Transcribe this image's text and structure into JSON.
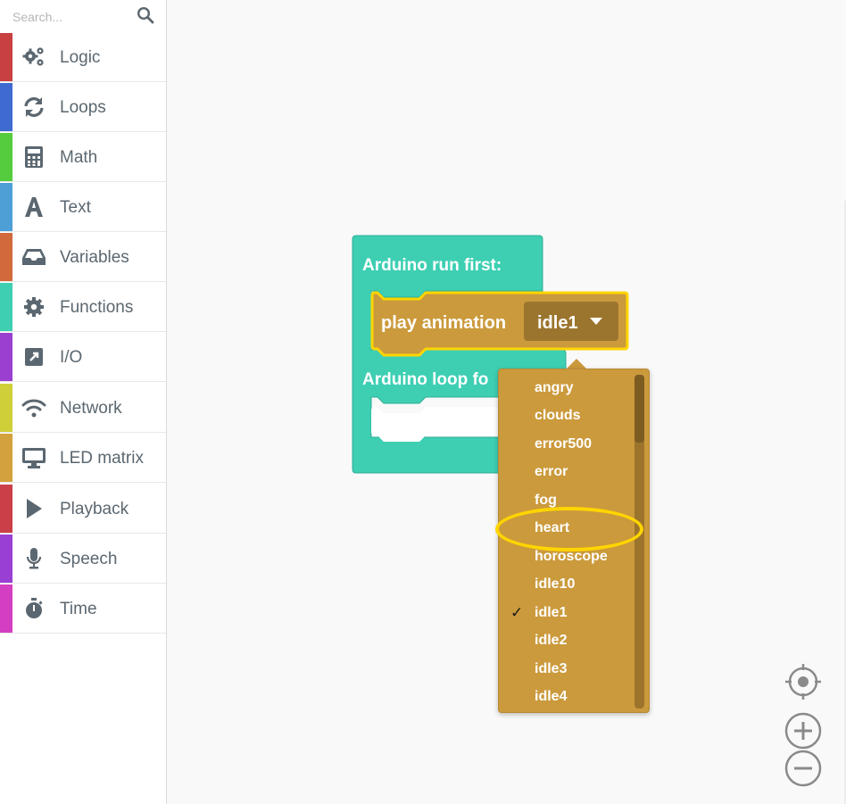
{
  "search": {
    "placeholder": "Search..."
  },
  "categories": [
    {
      "label": "Logic",
      "color": "#c94040",
      "icon": "gears-icon"
    },
    {
      "label": "Loops",
      "color": "#3f6bd1",
      "icon": "refresh-icon"
    },
    {
      "label": "Math",
      "color": "#55cc3d",
      "icon": "calculator-icon"
    },
    {
      "label": "Text",
      "color": "#4e9fd6",
      "icon": "text-a-icon"
    },
    {
      "label": "Variables",
      "color": "#d2693b",
      "icon": "inbox-icon"
    },
    {
      "label": "Functions",
      "color": "#3ecfb3",
      "icon": "gear-icon"
    },
    {
      "label": "I/O",
      "color": "#9b3fd1",
      "icon": "external-link-icon"
    },
    {
      "label": "Network",
      "color": "#cfcf3a",
      "icon": "wifi-icon"
    },
    {
      "label": "LED matrix",
      "color": "#d4a23c",
      "icon": "monitor-icon"
    },
    {
      "label": "Playback",
      "color": "#cb3f48",
      "icon": "play-icon"
    },
    {
      "label": "Speech",
      "color": "#9a3fd3",
      "icon": "microphone-icon"
    },
    {
      "label": "Time",
      "color": "#d43fc2",
      "icon": "stopwatch-icon"
    }
  ],
  "blocks": {
    "setup_label": "Arduino run first:",
    "loop_label": "Arduino loop fo",
    "play_label": "play animation",
    "selected_value": "idle1",
    "container_color": "#3ecfb3",
    "play_color": "#cb9a3c",
    "highlight_color": "#ffd500"
  },
  "dropdown": {
    "options": [
      "angry",
      "clouds",
      "error500",
      "error",
      "fog",
      "heart",
      "horoscope",
      "idle10",
      "idle1",
      "idle2",
      "idle3",
      "idle4"
    ],
    "checked": "idle1",
    "highlighted": "heart",
    "checkmark": "✓"
  },
  "zoom": {
    "controls": [
      "recenter-icon",
      "zoom-in-icon",
      "zoom-out-icon"
    ]
  }
}
